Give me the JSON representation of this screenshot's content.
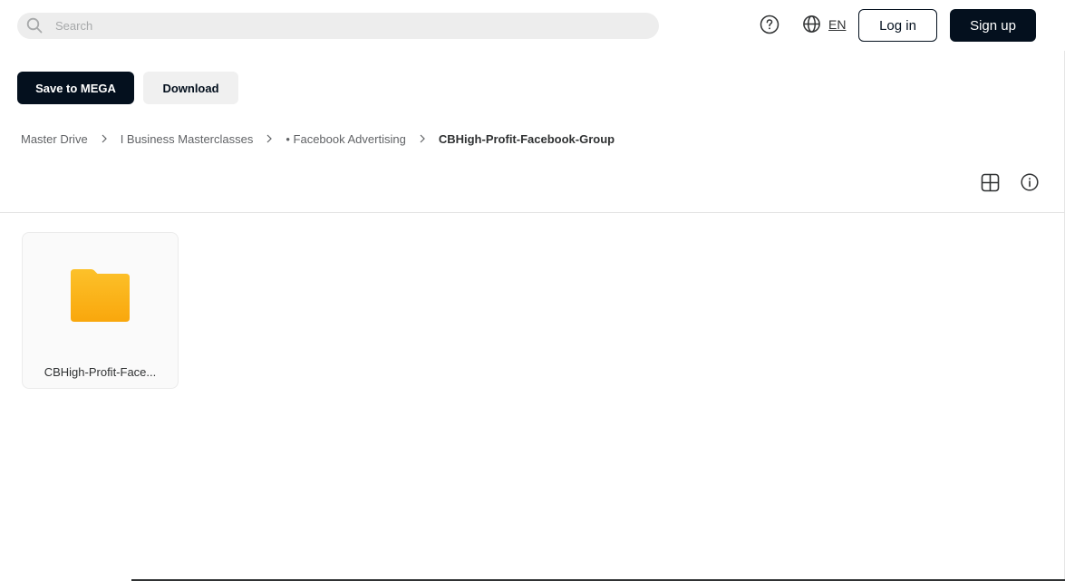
{
  "header": {
    "search": {
      "placeholder": "Search",
      "value": ""
    },
    "language": "EN",
    "login_label": "Log in",
    "signup_label": "Sign up"
  },
  "actions": {
    "save_label": "Save to MEGA",
    "download_label": "Download"
  },
  "breadcrumb": [
    {
      "label": "Master Drive"
    },
    {
      "label": "I Business Masterclasses"
    },
    {
      "label": "• Facebook Advertising"
    },
    {
      "label": "CBHigh-Profit-Facebook-Group"
    }
  ],
  "items": [
    {
      "name": "CBHigh-Profit-Face...",
      "type": "folder-icon"
    }
  ],
  "colors": {
    "primary": "#04101e",
    "folder": "#fbb515",
    "search_bg": "#ededed"
  }
}
